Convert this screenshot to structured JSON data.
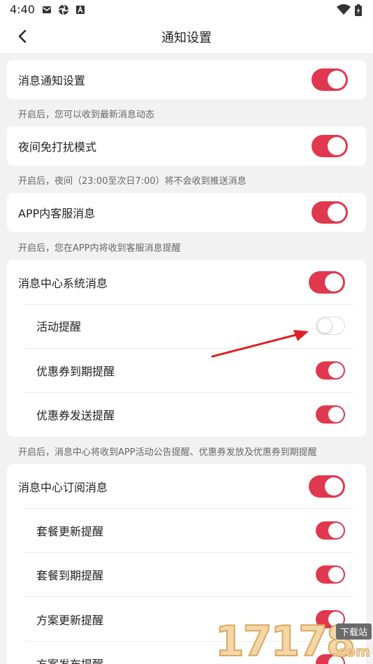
{
  "status_bar": {
    "time": "4:40",
    "icons_left": [
      "mail-icon",
      "app-icon",
      "a-letter-icon"
    ],
    "icons_right": [
      "wifi-icon",
      "battery-icon"
    ]
  },
  "header": {
    "title": "通知设置",
    "back_icon": "chevron-left-icon"
  },
  "settings": {
    "message_notify": {
      "label": "消息通知设置",
      "enabled": true,
      "hint": "开启后，您可以收到最新消息动态"
    },
    "night_mode": {
      "label": "夜间免打扰模式",
      "enabled": true,
      "hint": "开启后，夜间（23:00至次日7:00）将不会收到推送消息"
    },
    "app_service": {
      "label": "APP内客服消息",
      "enabled": true,
      "hint": "开启后，您在APP内将收到客服消息提醒"
    },
    "system_messages": {
      "label": "消息中心系统消息",
      "enabled": true,
      "items": [
        {
          "label": "活动提醒",
          "enabled": false
        },
        {
          "label": "优惠券到期提醒",
          "enabled": true
        },
        {
          "label": "优惠券发送提醒",
          "enabled": true
        }
      ],
      "hint": "开启后，消息中心将收到APP活动公告提醒、优惠券发放及优惠券到期提醒"
    },
    "subscription_messages": {
      "label": "消息中心订阅消息",
      "enabled": true,
      "items": [
        {
          "label": "套餐更新提醒",
          "enabled": true
        },
        {
          "label": "套餐到期提醒",
          "enabled": true
        },
        {
          "label": "方案更新提醒",
          "enabled": true
        },
        {
          "label": "方案发布提醒",
          "enabled": true
        }
      ]
    }
  },
  "colors": {
    "accent": "#e0384e",
    "background": "#f2f2f2",
    "arrow": "#e02020"
  },
  "watermark": {
    "digits": "17178",
    "badge": "下载站",
    "domain": ".com"
  }
}
